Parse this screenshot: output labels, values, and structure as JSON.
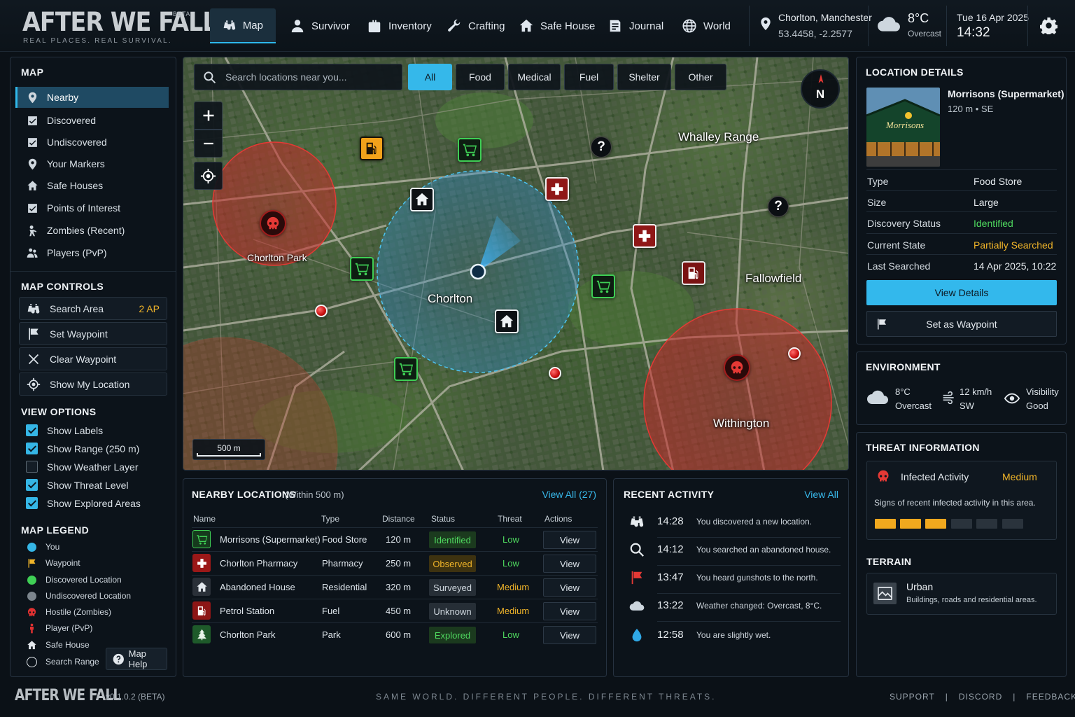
{
  "header": {
    "logo": "AFTER WE FALL",
    "logo_badge": "BETA",
    "tagline": "REAL PLACES. REAL SURVIVAL.",
    "nav": [
      {
        "label": "Map",
        "icon": "binoculars-icon",
        "active": true
      },
      {
        "label": "Survivor",
        "icon": "person-icon"
      },
      {
        "label": "Inventory",
        "icon": "backpack-icon"
      },
      {
        "label": "Crafting",
        "icon": "wrench-icon"
      },
      {
        "label": "Safe House",
        "icon": "house-icon"
      },
      {
        "label": "Journal",
        "icon": "journal-icon"
      },
      {
        "label": "World",
        "icon": "globe-icon"
      }
    ],
    "location_name": "Chorlton, Manchester",
    "location_coords": "53.4458, -2.2577",
    "weather_temp": "8°C",
    "weather_condition": "Overcast",
    "date": "Tue 16 Apr 2025",
    "time": "14:32"
  },
  "sidebar": {
    "map_heading": "MAP",
    "filters": [
      {
        "label": "Nearby",
        "icon": "pin-icon",
        "active": true
      },
      {
        "label": "Discovered",
        "icon": "checkbox-icon"
      },
      {
        "label": "Undiscovered",
        "icon": "checkbox-icon"
      },
      {
        "label": "Your Markers",
        "icon": "pin-icon"
      },
      {
        "label": "Safe Houses",
        "icon": "house-icon"
      },
      {
        "label": "Points of Interest",
        "icon": "checkbox-icon"
      },
      {
        "label": "Zombies (Recent)",
        "icon": "zombie-icon"
      },
      {
        "label": "Players (PvP)",
        "icon": "players-icon"
      }
    ],
    "controls_heading": "MAP CONTROLS",
    "controls": [
      {
        "label": "Search Area",
        "icon": "binoculars-icon",
        "badge": "2 AP"
      },
      {
        "label": "Set Waypoint",
        "icon": "flag-icon"
      },
      {
        "label": "Clear Waypoint",
        "icon": "close-icon"
      },
      {
        "label": "Show My Location",
        "icon": "crosshair-icon"
      }
    ],
    "view_heading": "VIEW OPTIONS",
    "view_options": [
      {
        "label": "Show Labels",
        "checked": true
      },
      {
        "label": "Show Range (250 m)",
        "checked": true
      },
      {
        "label": "Show Weather Layer",
        "checked": false
      },
      {
        "label": "Show Threat Level",
        "checked": true
      },
      {
        "label": "Show Explored Areas",
        "checked": true
      }
    ],
    "legend_heading": "MAP LEGEND",
    "legend": [
      {
        "label": "You",
        "icon": "you-dot-icon",
        "color": "#35b6e6"
      },
      {
        "label": "Waypoint",
        "icon": "flag-icon",
        "color": "#f0b429"
      },
      {
        "label": "Discovered Location",
        "icon": "dot-icon",
        "color": "#3fcf55"
      },
      {
        "label": "Undiscovered Location",
        "icon": "dot-icon",
        "color": "#7c858d"
      },
      {
        "label": "Hostile (Zombies)",
        "icon": "skull-icon",
        "color": "#e03131"
      },
      {
        "label": "Player (PvP)",
        "icon": "player-icon",
        "color": "#e03131"
      },
      {
        "label": "Safe House",
        "icon": "house-icon",
        "color": "#e3e8ed"
      },
      {
        "label": "Search Range",
        "icon": "ring-icon",
        "color": "#e3e8ed"
      }
    ],
    "help_label": "Map Help"
  },
  "map": {
    "search_placeholder": "Search locations near you...",
    "filters": [
      {
        "label": "All",
        "active": true
      },
      {
        "label": "Food"
      },
      {
        "label": "Medical"
      },
      {
        "label": "Fuel"
      },
      {
        "label": "Shelter"
      },
      {
        "label": "Other"
      }
    ],
    "compass_label": "N",
    "scale_label": "500 m",
    "area_labels": {
      "chorlton": "Chorlton",
      "chorlton_park": "Chorlton Park",
      "whalley_range": "Whalley Range",
      "fallowfield": "Fallowfield",
      "withington": "Withington"
    },
    "search_range_m": 250
  },
  "nearby": {
    "title": "NEARBY LOCATIONS",
    "subtitle": "(Within 500 m)",
    "view_all": "View All (27)",
    "columns": [
      "Name",
      "Type",
      "Distance",
      "Status",
      "Threat",
      "Actions"
    ],
    "rows": [
      {
        "name": "Morrisons (Supermarket)",
        "type": "Food Store",
        "distance": "120 m",
        "status": "Identified",
        "threat": "Low",
        "action": "View",
        "icon": "cart-icon"
      },
      {
        "name": "Chorlton Pharmacy",
        "type": "Pharmacy",
        "distance": "250 m",
        "status": "Observed",
        "threat": "Low",
        "action": "View",
        "icon": "medical-cross-icon"
      },
      {
        "name": "Abandoned House",
        "type": "Residential",
        "distance": "320 m",
        "status": "Surveyed",
        "threat": "Medium",
        "action": "View",
        "icon": "house-icon"
      },
      {
        "name": "Petrol Station",
        "type": "Fuel",
        "distance": "450 m",
        "status": "Unknown",
        "threat": "Medium",
        "action": "View",
        "icon": "fuel-pump-icon"
      },
      {
        "name": "Chorlton Park",
        "type": "Park",
        "distance": "600 m",
        "status": "Explored",
        "threat": "Low",
        "action": "View",
        "icon": "tree-icon"
      }
    ]
  },
  "activity": {
    "title": "RECENT ACTIVITY",
    "view_all": "View All",
    "items": [
      {
        "time": "14:28",
        "text": "You discovered a new location.",
        "icon": "binoculars-icon"
      },
      {
        "time": "14:12",
        "text": "You searched an abandoned house.",
        "icon": "search-icon"
      },
      {
        "time": "13:47",
        "text": "You heard gunshots to the north.",
        "icon": "flag-icon"
      },
      {
        "time": "13:22",
        "text": "Weather changed: Overcast, 8°C.",
        "icon": "cloud-icon"
      },
      {
        "time": "12:58",
        "text": "You are slightly wet.",
        "icon": "water-drop-icon"
      }
    ]
  },
  "location_details": {
    "title": "LOCATION DETAILS",
    "name": "Morrisons (Supermarket)",
    "distance": "120 m",
    "direction": "SE",
    "image_sign": "Morrisons",
    "fields": [
      {
        "key": "Type",
        "value": "Food Store"
      },
      {
        "key": "Size",
        "value": "Large"
      },
      {
        "key": "Discovery Status",
        "value": "Identified"
      },
      {
        "key": "Current State",
        "value": "Partially Searched"
      },
      {
        "key": "Last Searched",
        "value": "14 Apr 2025, 10:22"
      }
    ],
    "view_details": "View Details",
    "set_waypoint": "Set as Waypoint"
  },
  "environment": {
    "title": "ENVIRONMENT",
    "temp": "8°C",
    "condition": "Overcast",
    "wind_speed": "12 km/h",
    "wind_dir": "SW",
    "visibility_label": "Visibility",
    "visibility_value": "Good"
  },
  "threat": {
    "title": "THREAT INFORMATION",
    "label": "Infected Activity",
    "level": "Medium",
    "description": "Signs of recent infected activity in this area.",
    "level_bars_filled": 3,
    "level_bars_total": 6
  },
  "terrain": {
    "title": "TERRAIN",
    "type": "Urban",
    "description": "Buildings, roads and residential areas."
  },
  "footer": {
    "logo": "AFTER WE FALL",
    "version": "v0.1.0.2 (BETA)",
    "tagline": "SAME WORLD. DIFFERENT PEOPLE. DIFFERENT THREATS.",
    "links": [
      "SUPPORT",
      "DISCORD",
      "FEEDBACK"
    ]
  },
  "colors": {
    "accent": "#35b8ea",
    "good": "#3fcf55",
    "warn": "#f0b429",
    "danger": "#d6282b"
  }
}
